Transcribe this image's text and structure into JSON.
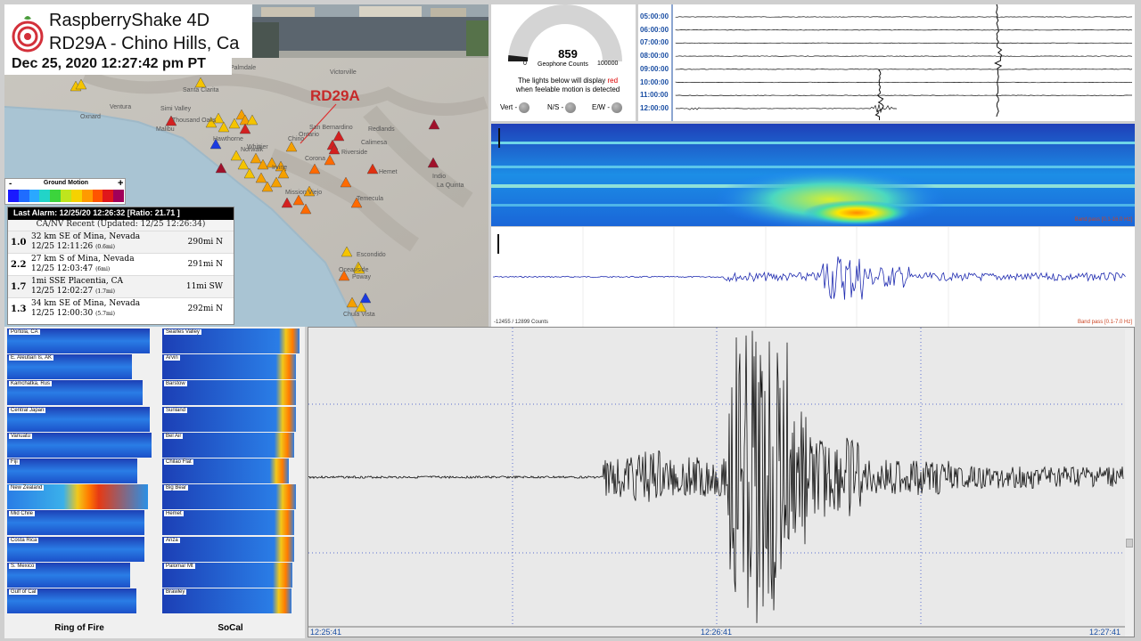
{
  "header": {
    "title_line1": "RaspberryShake 4D",
    "title_line2": "RD29A - Chino Hills, Ca",
    "datetime": "Dec 25, 2020  12:27:42 pm PT"
  },
  "map": {
    "station_label": "RD29A",
    "cities": [
      "Palmdale",
      "Victorville",
      "Santa Clarita",
      "Ventura",
      "Oxnard",
      "Simi Valley",
      "Thousand Oaks",
      "Malibu",
      "Hawthorne",
      "Norwalk",
      "Whittier",
      "Chino",
      "Ontario",
      "San Bernardino",
      "Redlands",
      "Riverside",
      "Corona",
      "Irvine",
      "Mission Viejo",
      "Temecula",
      "Oceanside",
      "Escondido",
      "Poway",
      "Chula Vista",
      "Indio",
      "La Quinta",
      "Calimesa",
      "Hemet"
    ]
  },
  "legend": {
    "title": "Ground Motion",
    "minus": "-",
    "plus": "+",
    "colors": [
      "#1a1aff",
      "#1f6cff",
      "#2aa8ff",
      "#22d4c8",
      "#3cd43c",
      "#bfe51d",
      "#f6d200",
      "#ff9a00",
      "#ff5400",
      "#e0161b",
      "#a1005a"
    ]
  },
  "quakes": {
    "header": "Last Alarm: 12/25/20 12:26:32  [Ratio: 21.71 ]",
    "subheader": "CA/NV Recent (Updated: 12/25 12:26:34)",
    "rows": [
      {
        "mag": "1.0",
        "place": "32 km SE of Mina, Nevada",
        "time": "12/25 12:11:26",
        "ago": "(0.6mi)",
        "dist": "290mi N"
      },
      {
        "mag": "2.2",
        "place": "27 km S of Mina, Nevada",
        "time": "12/25 12:03:47",
        "ago": "(6mi)",
        "dist": "291mi N"
      },
      {
        "mag": "1.7",
        "place": "1mi SSE Placentia, CA",
        "time": "12/25 12:02:27",
        "ago": "(1.7mi)",
        "dist": "11mi SW"
      },
      {
        "mag": "1.3",
        "place": "34 km SE of Mina, Nevada",
        "time": "12/25 12:00:30",
        "ago": "(5.7mi)",
        "dist": "292mi N"
      }
    ]
  },
  "gauge": {
    "value": "859",
    "min": "0",
    "max": "100000",
    "unit": "Geophone Counts",
    "note_prefix": "The lights below will display ",
    "note_red": "red",
    "note_line2": "when feelable motion is detected",
    "level_fraction": 0.00859,
    "lights": [
      {
        "label": "Vert -"
      },
      {
        "label": "N/S -"
      },
      {
        "label": "E/W -"
      }
    ]
  },
  "helicorder": {
    "hours": [
      "05:00:00",
      "06:00:00",
      "07:00:00",
      "08:00:00",
      "09:00:00",
      "10:00:00",
      "11:00:00",
      "12:00:00"
    ]
  },
  "spectrogram": {
    "band": "Band pass [0.1-16.0 Hz]"
  },
  "trace": {
    "counts": "-12455 / 12899 Counts",
    "band": "Band pass [0.1-7.0 Hz]"
  },
  "mosaic": {
    "left_title": "Ring of Fire",
    "right_title": "SoCal",
    "left": [
      "Portola, CA",
      "E. Aleutian Is, AK",
      "Kamchatka, Rus",
      "Central Japan",
      "Vanuatu",
      "Fiji",
      "New Zealand",
      "Mid Chile",
      "Costa Rica",
      "S. Mexico",
      "Gulf of Cal"
    ],
    "right": [
      "Searles Valley",
      "Arvin",
      "Barstow",
      "Sunland",
      "Bel Air",
      "Chilao Flat",
      "Big Bear",
      "Hemet",
      "Anza",
      "Palomar Mt",
      "Brawley"
    ]
  },
  "seismogram": {
    "times": [
      "12:25:41",
      "12:26:41",
      "12:27:41"
    ]
  }
}
